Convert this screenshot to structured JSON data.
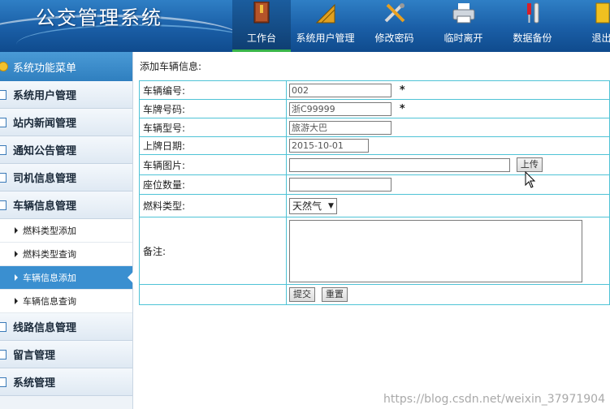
{
  "app": {
    "title": "公交管理系统"
  },
  "nav": [
    {
      "label": "工作台",
      "icon": "book-icon"
    },
    {
      "label": "系统用户管理",
      "icon": "ruler-icon"
    },
    {
      "label": "修改密码",
      "icon": "tools-icon"
    },
    {
      "label": "临时离开",
      "icon": "printer-icon"
    },
    {
      "label": "数据备份",
      "icon": "screwdriver-icon"
    },
    {
      "label": "退出",
      "icon": "exit-icon"
    }
  ],
  "sidebar": {
    "header": "系统功能菜单",
    "items": [
      {
        "label": "系统用户管理"
      },
      {
        "label": "站内新闻管理"
      },
      {
        "label": "通知公告管理"
      },
      {
        "label": "司机信息管理"
      },
      {
        "label": "车辆信息管理"
      },
      {
        "label": "线路信息管理"
      },
      {
        "label": "留言管理"
      },
      {
        "label": "系统管理"
      }
    ],
    "sub_items": [
      {
        "label": "燃料类型添加"
      },
      {
        "label": "燃料类型查询"
      },
      {
        "label": "车辆信息添加"
      },
      {
        "label": "车辆信息查询"
      }
    ]
  },
  "main": {
    "title": "添加车辆信息:",
    "fields": {
      "vehicle_no": {
        "label": "车辆编号:",
        "value": "002",
        "required": "*"
      },
      "plate_no": {
        "label": "车牌号码:",
        "value": "浙C99999",
        "required": "*"
      },
      "model": {
        "label": "车辆型号:",
        "value": "旅游大巴"
      },
      "plate_date": {
        "label": "上牌日期:",
        "value": "2015-10-01"
      },
      "photo": {
        "label": "车辆图片:",
        "value": "",
        "upload_label": "上传"
      },
      "seats": {
        "label": "座位数量:",
        "value": ""
      },
      "fuel": {
        "label": "燃料类型:",
        "value": "天然气"
      },
      "remark": {
        "label": "备注:",
        "value": ""
      }
    },
    "submit_label": "提交",
    "reset_label": "重置"
  },
  "watermark": "https://blog.csdn.net/weixin_37971904",
  "colors": {
    "header": "#1a5ea6",
    "active_sub": "#3a8fd0",
    "table_border": "#4fc3d6",
    "active_nav_underline": "#39b54a"
  }
}
